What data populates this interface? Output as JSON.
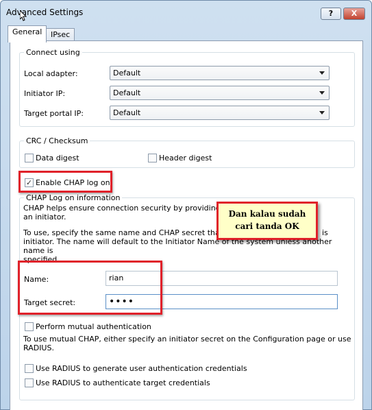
{
  "window": {
    "title": "Advanced Settings",
    "help_label": "?",
    "close_label": "X"
  },
  "tabs": [
    {
      "label": "General",
      "active": true
    },
    {
      "label": "IPsec",
      "active": false
    }
  ],
  "connect_using": {
    "legend": "Connect using",
    "local_adapter": {
      "label": "Local adapter:",
      "value": "Default"
    },
    "initiator_ip": {
      "label": "Initiator IP:",
      "value": "Default"
    },
    "target_portal_ip": {
      "label": "Target portal IP:",
      "value": "Default"
    }
  },
  "crc": {
    "legend": "CRC / Checksum",
    "data_digest": {
      "label": "Data digest",
      "checked": false
    },
    "header_digest": {
      "label": "Header digest",
      "checked": false
    }
  },
  "chap": {
    "enable": {
      "label": "Enable CHAP log on",
      "checked": true
    },
    "legend": "CHAP Log on information",
    "desc1_line1": "CHAP helps ensure connection security by providing authen",
    "desc1_line2": "an initiator.",
    "desc2_line1": "To use, specify the same name and CHAP secret that was c",
    "desc2_line1_end": "is",
    "desc2_line2": "initiator.  The name will default to the Initiator Name of the system unless another name is",
    "desc2_line3": "specified.",
    "name": {
      "label": "Name:",
      "value": "rian"
    },
    "target_secret": {
      "label": "Target secret:",
      "value": "••••"
    },
    "mutual": {
      "label": "Perform mutual authentication",
      "checked": false
    },
    "mutual_desc_line1": "To use mutual CHAP, either specify an initiator secret on the Configuration page or use",
    "mutual_desc_line2": "RADIUS.",
    "radius_user": {
      "label": "Use RADIUS to generate user authentication credentials",
      "checked": false
    },
    "radius_target": {
      "label": "Use RADIUS to authenticate target credentials",
      "checked": false
    }
  },
  "annotation": {
    "line1": "Dan kalau sudah",
    "line2": "cari tanda OK"
  },
  "colors": {
    "highlight": "#e0212a",
    "note_bg": "#ffffc8"
  },
  "icons": {
    "cursor": "mouse-pointer-icon",
    "dropdown": "chevron-down-icon",
    "check": "checkmark-icon"
  }
}
